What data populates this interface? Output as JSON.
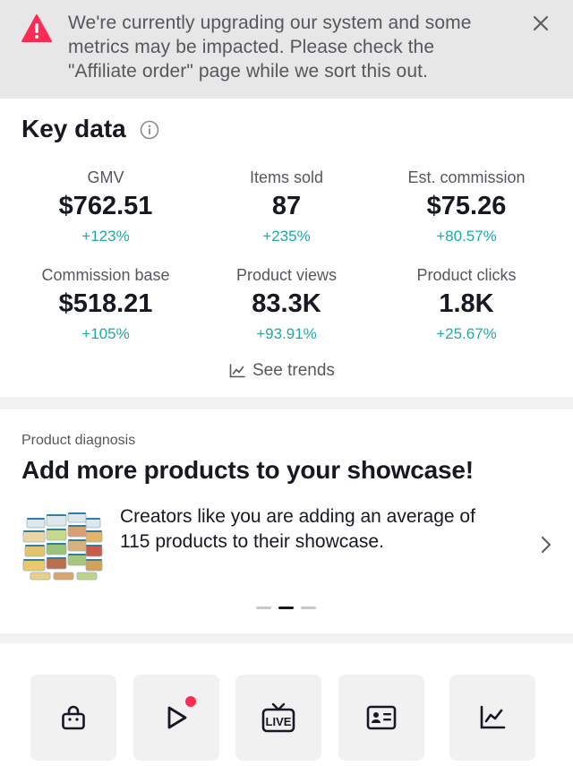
{
  "banner": {
    "line1": "We're currently upgrading our system and some",
    "line2": "metrics may be impacted. Please check the",
    "line3": "\"Affiliate order\" page while we sort this out.",
    "icon": "alert-icon",
    "close_icon": "close-icon",
    "colors": {
      "alert": "#fe2c55",
      "background": "#e7e7e8"
    }
  },
  "key_data": {
    "title": "Key data",
    "metrics": [
      {
        "label": "GMV",
        "value": "$762.51",
        "change": "+123%"
      },
      {
        "label": "Items sold",
        "value": "87",
        "change": "+235%"
      },
      {
        "label": "Est. commission",
        "value": "$75.26",
        "change": "+80.57%"
      },
      {
        "label": "Commission base",
        "value": "$518.21",
        "change": "+105%"
      },
      {
        "label": "Product views",
        "value": "83.3K",
        "change": "+93.91%"
      },
      {
        "label": "Product clicks",
        "value": "1.8K",
        "change": "+25.67%"
      }
    ],
    "see_trends": "See trends",
    "colors": {
      "change": "#1fa9a8"
    }
  },
  "diagnosis": {
    "kicker": "Product diagnosis",
    "title": "Add more products to your showcase!",
    "line1": "Creators like you are adding an average of",
    "line2": "115 products to their showcase.",
    "carousel": {
      "pages": 3,
      "active": 2
    }
  },
  "actions": [
    {
      "icon": "shopping-bag-icon"
    },
    {
      "icon": "play-icon",
      "badge": true
    },
    {
      "icon": "live-icon",
      "text": "LIVE"
    },
    {
      "icon": "id-card-icon"
    },
    {
      "icon": "trend-chart-icon"
    }
  ]
}
